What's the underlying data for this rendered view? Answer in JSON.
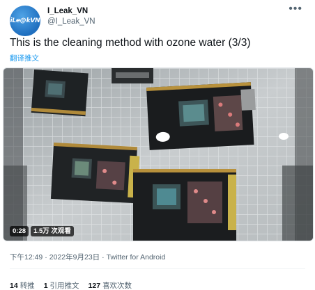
{
  "author": {
    "avatar_text": "iLe@kVN",
    "display_name": "I_Leak_VN",
    "handle": "@I_Leak_VN"
  },
  "more_icon": "•••",
  "tweet": {
    "text": "This is the cleaning method with ozone water (3/3)",
    "translate_label": "翻译推文"
  },
  "video": {
    "duration": "0:28",
    "views": "1.5万 次观看"
  },
  "meta": {
    "time": "下午12:49",
    "date": "2022年9月23日",
    "separator": "·",
    "source": "Twitter for Android"
  },
  "stats": [
    {
      "count": "14",
      "label": "转推"
    },
    {
      "count": "1",
      "label": "引用推文"
    },
    {
      "count": "127",
      "label": "喜欢次数"
    }
  ],
  "colors": {
    "link": "#1d9bf0",
    "secondary_text": "#536471",
    "primary_text": "#0f1419"
  }
}
